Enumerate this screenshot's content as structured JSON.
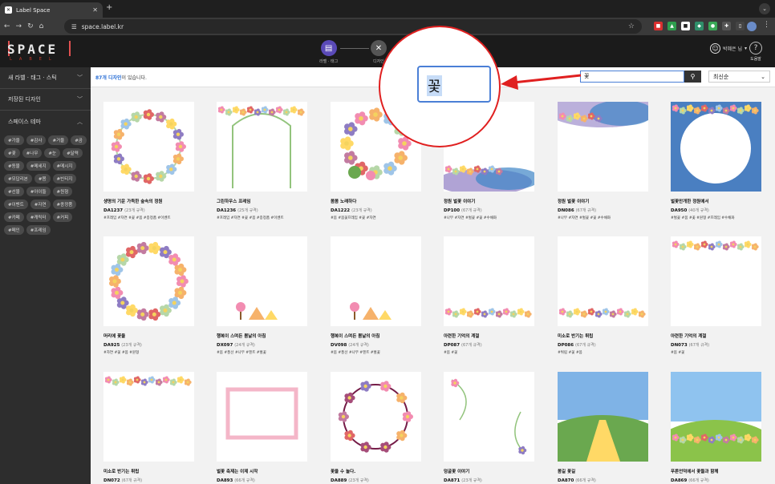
{
  "browser": {
    "tab_title": "Label Space",
    "favicon_glyph": "✕",
    "url": "space.label.kr",
    "new_tab": "+",
    "dropdown": "⌄",
    "kebab": "⋮"
  },
  "header": {
    "logo": "SPACE",
    "logo_sub": "LABEL",
    "steps": [
      {
        "label": "라벨 · 태그",
        "icon": "label-icon",
        "color": "#5a4ab8"
      },
      {
        "label": "디자인",
        "icon": "tools-icon",
        "color": "#555555"
      }
    ],
    "user_name": "박혜은 님",
    "help_label": "도움말"
  },
  "sidebar": {
    "sections": [
      {
        "label": "새 라벨 · 태그 · 스틱",
        "open": false
      },
      {
        "label": "저장된 디자인",
        "open": false
      },
      {
        "label": "스페이스 테마",
        "open": true
      }
    ],
    "chips": [
      "#가을",
      "#감사",
      "#거울",
      "#곰",
      "#꽃",
      "#나무",
      "#눈",
      "#달력",
      "#동물",
      "#메세지",
      "#메시지",
      "#모답리본",
      "#봄",
      "#빈티지",
      "#선물",
      "#아이들",
      "#원형",
      "#이벤트",
      "#자연",
      "#종정품",
      "#카페",
      "#캐릭터",
      "#커피",
      "#페인",
      "#프레임"
    ]
  },
  "main": {
    "count_num": "87개 디자인",
    "count_suffix": "이 있습니다.",
    "search_value": "꽃",
    "search_icon": "search-icon",
    "sort_value": "최신순",
    "magnified_text": "꽃",
    "items": [
      {
        "title": "생명의 기운 가득한 숲속의 정원",
        "code": "DA1237",
        "spec": "(23개 규격)",
        "tags": "#프레임 #자연 #꽃 #봄 #종정품 #이벤트",
        "art": "wreath-forest"
      },
      {
        "title": "그린하우스 프레임",
        "code": "DA1236",
        "spec": "(25개 규격)",
        "tags": "#프레임 #자연 #꽃 #봄 #종정품 #이벤트",
        "art": "arch-frame"
      },
      {
        "title": "봄봄 노래하다",
        "code": "DA1222",
        "spec": "(23개 규격)",
        "tags": "#봄 #봄꽃프레임 #꽃 #자연",
        "art": "spring-wreath"
      },
      {
        "title": "정원 벌꽃 이야기",
        "code": "DP100",
        "spec": "(67개 규격)",
        "tags": "#나무 #자연 #벌꽃 #꽃 #수채화",
        "art": "watercolor-bottom"
      },
      {
        "title": "정원 벌꽃 이야기",
        "code": "DN086",
        "spec": "(67개 규격)",
        "tags": "#나무 #자연 #벌꽃 #꽃 #수채화",
        "art": "watercolor-top"
      },
      {
        "title": "벌꽃만개한 정원에서",
        "code": "DA950",
        "spec": "(40개 규격)",
        "tags": "#벌꽃 #봄 #꽃 #원형 #프레임 #수채화",
        "art": "blossom-circle"
      },
      {
        "title": "머리에 꽃을",
        "code": "DA925",
        "spec": "(23개 규격)",
        "tags": "#자연 #꽃 #봄 #원형",
        "art": "flower-ring"
      },
      {
        "title": "행복이 스며든 봄날의 아침",
        "code": "DX097",
        "spec": "(24개 규격)",
        "tags": "#봄 #풍선 #나무 #텐트 #벌꽃",
        "art": "tent-scene"
      },
      {
        "title": "행복이 스며든 봄날의 아침",
        "code": "DV098",
        "spec": "(24개 규격)",
        "tags": "#봄 #풍선 #나무 #텐트 #벌꽃",
        "art": "tent-scene"
      },
      {
        "title": "아련한 기억의 계절",
        "code": "DP087",
        "spec": "(67개 규격)",
        "tags": "#봄 #꽃",
        "art": "flower-strip-bottom"
      },
      {
        "title": "미소로 반기는 튀립",
        "code": "DP086",
        "spec": "(67개 규격)",
        "tags": "#튀립 #꽃 #봄",
        "art": "flower-strip-bottom"
      },
      {
        "title": "아련한 기억의 계절",
        "code": "DN073",
        "spec": "(67개 규격)",
        "tags": "#봄 #꽃",
        "art": "flower-strip-top"
      },
      {
        "title": "미소로 반기는 튀립",
        "code": "DN072",
        "spec": "(67개 규격)",
        "tags": "",
        "art": "flower-strip-top"
      },
      {
        "title": "벌꽃 축제는 이제 시작",
        "code": "DA893",
        "spec": "(66개 규격)",
        "tags": "",
        "art": "blossom-rect"
      },
      {
        "title": "꽃을 수 놀다.",
        "code": "DA889",
        "spec": "(23개 규격)",
        "tags": "",
        "art": "dark-wreath"
      },
      {
        "title": "덩굴꽃 이야기",
        "code": "DA871",
        "spec": "(23개 규격)",
        "tags": "",
        "art": "vine-corner"
      },
      {
        "title": "봄길 꽃길",
        "code": "DA870",
        "spec": "(66개 규격)",
        "tags": "",
        "art": "meadow-path"
      },
      {
        "title": "푸른언덕에서 꽃들과 함께",
        "code": "DA869",
        "spec": "(66개 규격)",
        "tags": "",
        "art": "meadow-hill"
      }
    ]
  }
}
